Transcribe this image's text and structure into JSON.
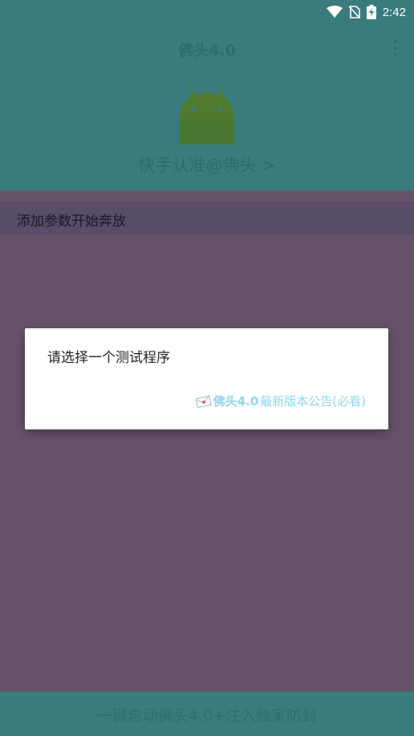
{
  "status_bar": {
    "time": "2:42",
    "icons": [
      "wifi-icon",
      "no-sim-icon",
      "battery-charging-icon"
    ]
  },
  "header": {
    "title": "佛头4.0",
    "menu_icon": "more-vert-icon",
    "logo_icon": "android-icon",
    "link_text": "快手认准@佛头 >"
  },
  "param_bar": {
    "label": "添加参数开始奔放"
  },
  "dialog": {
    "title": "请选择一个测试程序",
    "notice_icon": "envelope-icon",
    "notice_link_bold": "佛头4.0",
    "notice_link_rest": "最新版本公告(必看)"
  },
  "bottom_bar": {
    "label": "一键启动佛头4.0+注入独家防封"
  },
  "colors": {
    "header_bg": "#3a7c7d",
    "body_bg": "#66536a",
    "param_bar_bg": "#574c6a",
    "dialog_link": "#8ad7ef"
  }
}
